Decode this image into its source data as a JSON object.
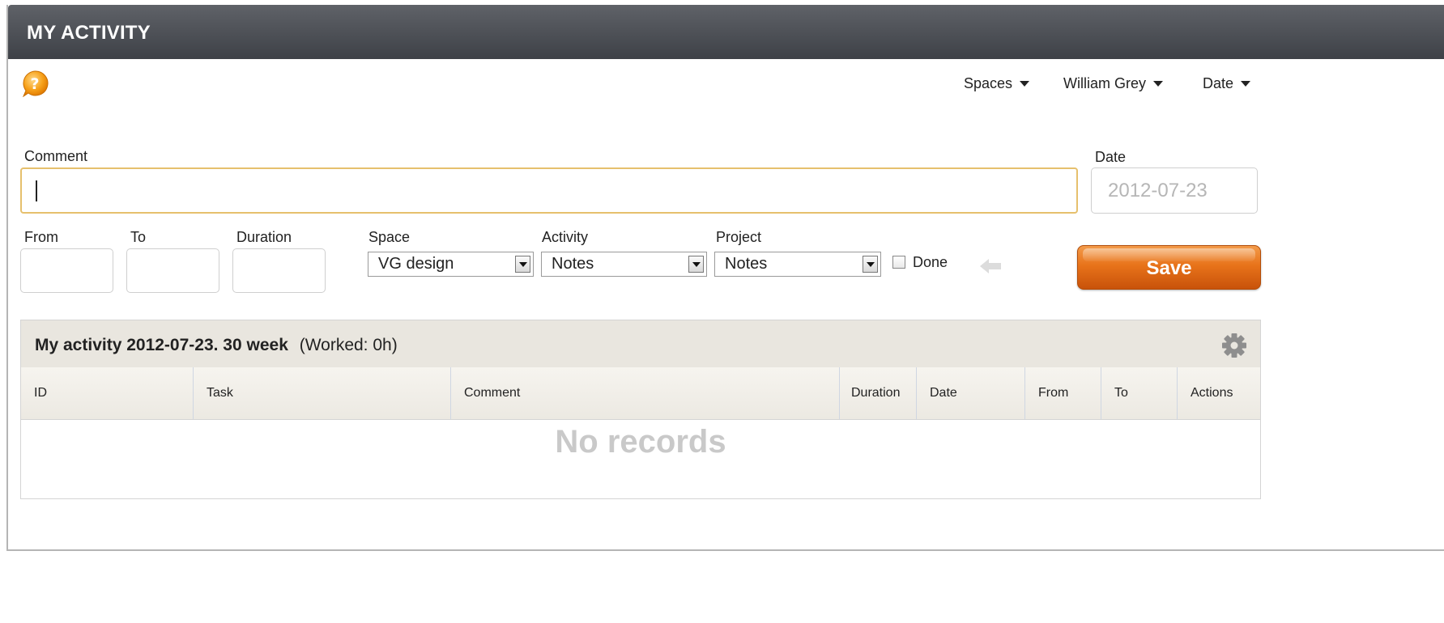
{
  "header": {
    "title": "MY ACTIVITY"
  },
  "topnav": [
    {
      "label": "Spaces"
    },
    {
      "label": "William Grey"
    },
    {
      "label": "Date"
    }
  ],
  "form": {
    "comment_label": "Comment",
    "comment_value": "",
    "date_label": "Date",
    "date_placeholder": "2012-07-23",
    "from_label": "From",
    "to_label": "To",
    "duration_label": "Duration",
    "space_label": "Space",
    "space_value": "VG design",
    "activity_label": "Activity",
    "activity_value": "Notes",
    "project_label": "Project",
    "project_value": "Notes",
    "done_label": "Done",
    "done_checked": false,
    "save_label": "Save"
  },
  "panel": {
    "title_bold": "My activity 2012-07-23. 30 week",
    "title_extra": "(Worked: 0h)",
    "columns": [
      "ID",
      "Task",
      "Comment",
      "Duration",
      "Date",
      "From",
      "To",
      "Actions"
    ],
    "empty_text": "No records"
  },
  "colors": {
    "save": "#e8731a",
    "titlebar": "#4a4d52",
    "focus_border": "#e6c06d"
  },
  "icons": [
    "help-icon",
    "arrow-left-icon",
    "gear-icon",
    "chevron-down-icon"
  ]
}
